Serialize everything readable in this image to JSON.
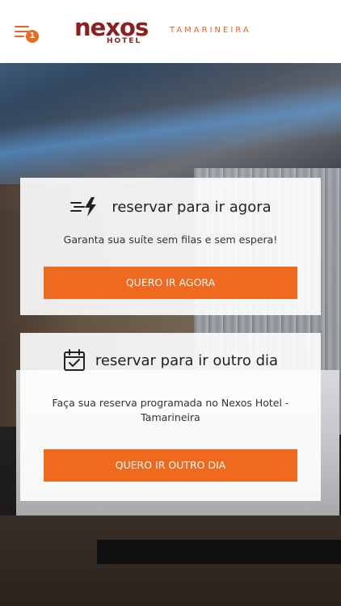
{
  "header": {
    "brand": "nexos",
    "brand_sub": "HOTEL",
    "location": "TAMARINEIRA",
    "menu_badge": "1",
    "menu_icon": "hamburger-menu-icon",
    "brand_color": "#8c1f1f",
    "accent_color": "#ef6a1f"
  },
  "cards": [
    {
      "icon": "fast-lightning-icon",
      "title": "reservar para ir agora",
      "description": "Garanta sua suíte sem filas e sem espera!",
      "button": "QUERO IR AGORA"
    },
    {
      "icon": "calendar-check-icon",
      "title": "reservar para ir outro dia",
      "description": "Faça sua reserva programada no Nexos Hotel - Tamarineira",
      "button": "QUERO IR OUTRO DIA"
    }
  ]
}
